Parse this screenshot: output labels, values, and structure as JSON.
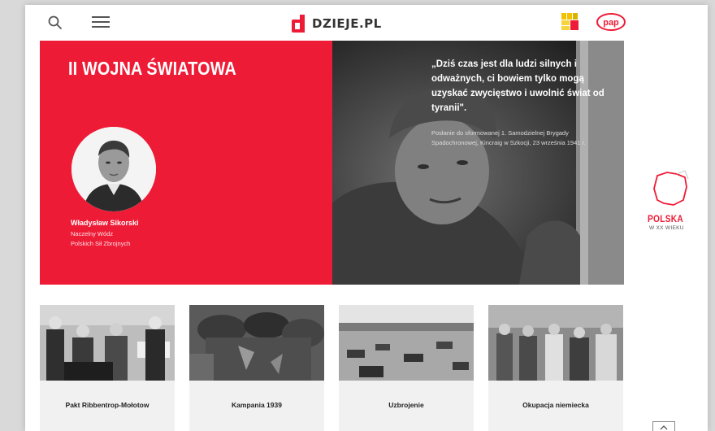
{
  "header": {
    "logo_text": "DZIEJE.PL",
    "partner2_text": "pap"
  },
  "hero": {
    "title": "II WOJNA ŚWIATOWA",
    "person_name": "Władysław Sikorski",
    "person_role_line1": "Naczelny Wódz",
    "person_role_line2": "Polskich Sił Zbrojnych",
    "quote": "„Dziś czas jest dla ludzi silnych i odważnych, ci bowiem tylko mogą uzyskać zwycięstwo i uwolnić świat od tyranii\".",
    "quote_source": "Posłanie do sformowanej 1. Samodzielnej Brygady Spadochronowej, Kincraig w Szkocji, 23 września 1941 r."
  },
  "side_widget": {
    "title": "POLSKA",
    "subtitle": "W XX WIEKU"
  },
  "cards": [
    {
      "label": "Pakt Ribbentrop-Mołotow"
    },
    {
      "label": "Kampania 1939"
    },
    {
      "label": "Uzbrojenie"
    },
    {
      "label": "Okupacja niemiecka"
    }
  ],
  "colors": {
    "accent": "#ee1b36",
    "dark": "#2a2a2a"
  }
}
